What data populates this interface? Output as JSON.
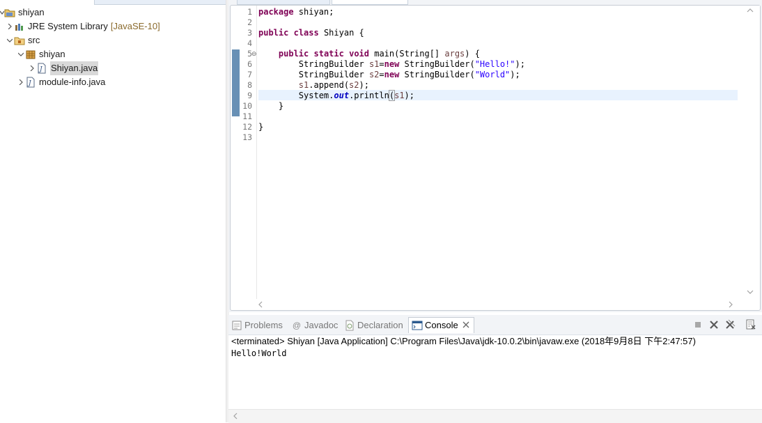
{
  "explorer": {
    "project": "shiyan",
    "jre_label": "JRE System Library",
    "jre_decor": "[JavaSE-10]",
    "src_label": "src",
    "package_label": "shiyan",
    "file_selected": "Shiyan.java",
    "file_module": "module-info.java"
  },
  "editor": {
    "line_numbers": [
      "1",
      "2",
      "3",
      "4",
      "5",
      "6",
      "7",
      "8",
      "9",
      "10",
      "11",
      "12",
      "13"
    ],
    "fold_marker": "⊖"
  },
  "console": {
    "tabs": {
      "problems": "Problems",
      "javadoc": "Javadoc",
      "declaration": "Declaration",
      "console": "Console"
    },
    "status": "<terminated> Shiyan [Java Application] C:\\Program Files\\Java\\jdk-10.0.2\\bin\\javaw.exe (2018年9月8日 下午2:47:57)",
    "output": "Hello!World"
  },
  "colors": {
    "keyword": "#7f0055",
    "string": "#2a00ff",
    "local_variable": "#6a3e3e",
    "static_field": "#0000c0",
    "change_bar": "#4e7da8",
    "current_line": "#e8f2fe"
  },
  "icons": [
    "project-icon",
    "library-icon",
    "source-folder-icon",
    "package-icon",
    "java-file-icon",
    "problems-icon",
    "javadoc-icon",
    "declaration-icon",
    "console-icon",
    "terminate-icon",
    "remove-launch-icon",
    "remove-all-icon",
    "clear-console-icon"
  ]
}
